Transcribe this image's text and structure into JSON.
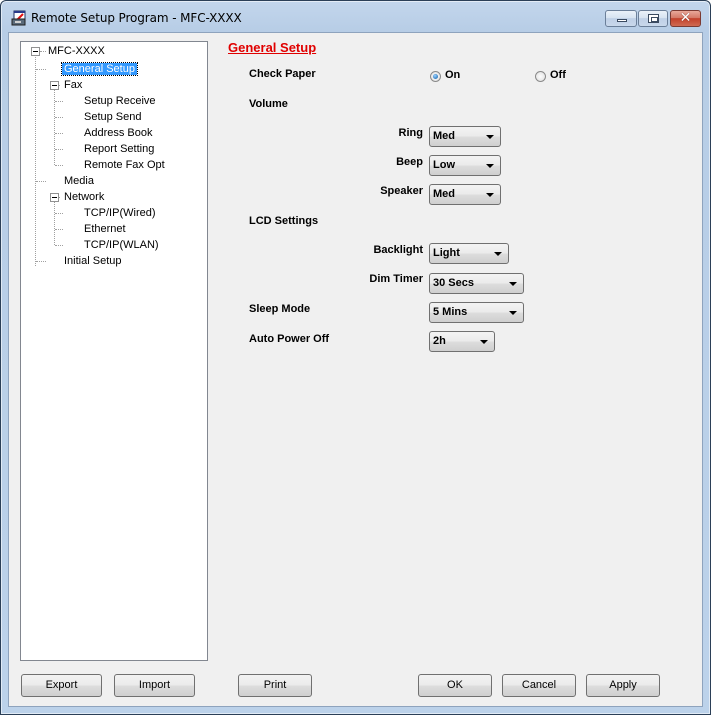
{
  "window": {
    "title": "Remote Setup Program - MFC-XXXX",
    "icon": "printer-fax-icon",
    "controls": [
      "minimize",
      "maximize",
      "close"
    ]
  },
  "tree": {
    "root": "MFC-XXXX",
    "items": [
      {
        "label": "General Setup",
        "selected": true
      },
      {
        "label": "Fax",
        "expanded": true
      },
      {
        "label": "Setup Receive"
      },
      {
        "label": "Setup Send"
      },
      {
        "label": "Address Book"
      },
      {
        "label": "Report Setting"
      },
      {
        "label": "Remote Fax Opt"
      },
      {
        "label": "Media"
      },
      {
        "label": "Network",
        "expanded": true
      },
      {
        "label": "TCP/IP(Wired)"
      },
      {
        "label": "Ethernet"
      },
      {
        "label": "TCP/IP(WLAN)"
      },
      {
        "label": "Initial Setup"
      }
    ]
  },
  "panel": {
    "title": "General Setup",
    "title_color": "#e00000",
    "check_paper": {
      "label": "Check Paper",
      "options": [
        {
          "label": "On",
          "checked": true
        },
        {
          "label": "Off",
          "checked": false
        }
      ]
    },
    "volume": {
      "label": "Volume",
      "ring": {
        "label": "Ring",
        "value": "Med"
      },
      "beep": {
        "label": "Beep",
        "value": "Low"
      },
      "speaker": {
        "label": "Speaker",
        "value": "Med"
      }
    },
    "lcd": {
      "label": "LCD Settings",
      "backlight": {
        "label": "Backlight",
        "value": "Light"
      },
      "dim_timer": {
        "label": "Dim Timer",
        "value": "30 Secs"
      }
    },
    "sleep_mode": {
      "label": "Sleep Mode",
      "value": "5 Mins"
    },
    "auto_power_off": {
      "label": "Auto Power Off",
      "value": "2h"
    }
  },
  "buttons": {
    "export": "Export",
    "import": "Import",
    "print": "Print",
    "ok": "OK",
    "cancel": "Cancel",
    "apply": "Apply"
  }
}
